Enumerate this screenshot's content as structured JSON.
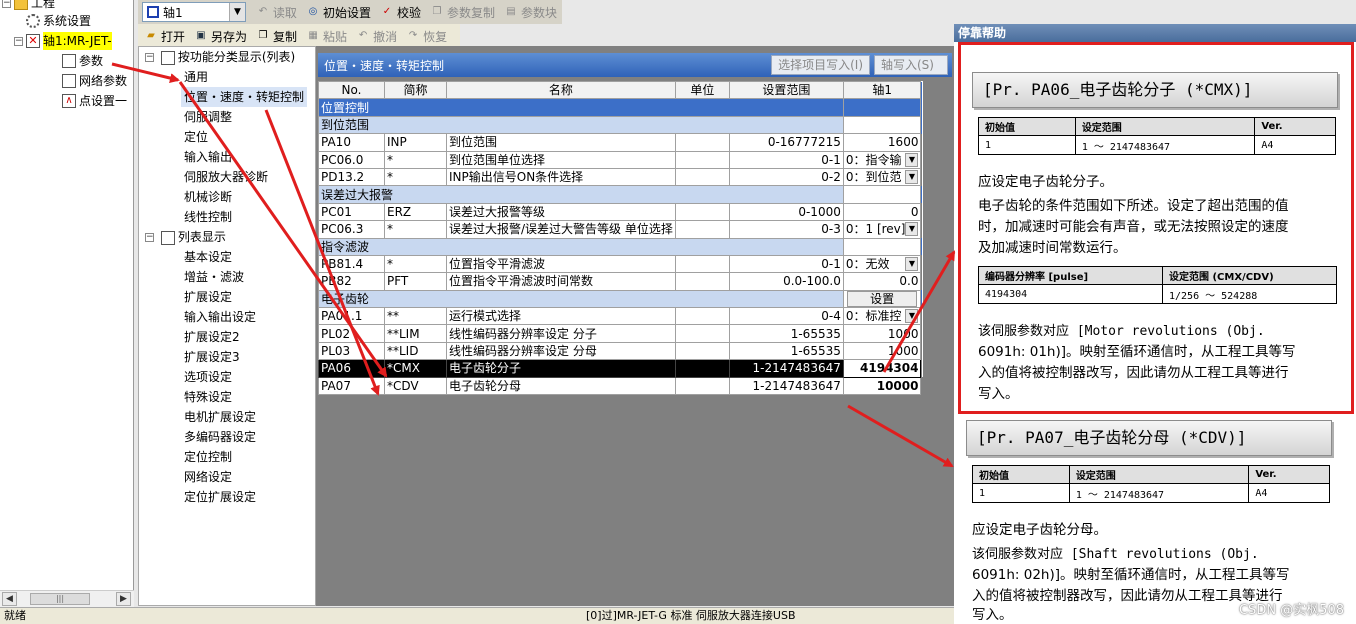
{
  "tree": {
    "project": "工程",
    "system_settings": "系统设置",
    "axis": "轴1:MR-JET-",
    "parameter": "参数",
    "network_parameter": "网络参数",
    "point_settings": "点设置一"
  },
  "toolbar": {
    "axis_select": "轴1",
    "read": "读取",
    "init_settings": "初始设置",
    "verify": "校验",
    "param_copy": "参数复制",
    "param_block": "参数块",
    "open": "打开",
    "save_as": "另存为",
    "copy": "复制",
    "paste": "粘贴",
    "undo": "撤消",
    "redo": "恢复"
  },
  "category": {
    "by_function": "按功能分类显示(列表)",
    "items_func": [
      "通用",
      "位置・速度・转矩控制",
      "伺服调整",
      "定位",
      "输入输出",
      "伺服放大器诊断",
      "机械诊断",
      "线性控制"
    ],
    "list_display": "列表显示",
    "items_list": [
      "基本设定",
      "增益・滤波",
      "扩展设定",
      "输入输出设定",
      "扩展设定2",
      "扩展设定3",
      "选项设定",
      "特殊设定",
      "电机扩展设定",
      "多编码器设定",
      "定位控制",
      "网络设定",
      "定位扩展设定"
    ]
  },
  "grid": {
    "title": "位置・速度・转矩控制",
    "btn_write_selected": "选择项目写入(I)",
    "btn_axis_write": "轴写入(S)",
    "columns": [
      "No.",
      "简称",
      "名称",
      "单位",
      "设置范围",
      "轴1"
    ],
    "section_position": "位置控制",
    "group_inpos": "到位范围",
    "group_error": "误差过大报警",
    "group_filter": "指令滤波",
    "group_gear": "电子齿轮",
    "gear_setting_btn": "设置",
    "rows_inpos": [
      {
        "no": "PA10",
        "abbr": "INP",
        "name": "到位范围",
        "unit": "",
        "range": "0-16777215",
        "value": "1600"
      },
      {
        "no": "PC06.0",
        "abbr": "*",
        "name": "到位范围单位选择",
        "unit": "",
        "range": "0-1",
        "value": "0：指令输"
      },
      {
        "no": "PD13.2",
        "abbr": "*",
        "name": "INP输出信号ON条件选择",
        "unit": "",
        "range": "0-2",
        "value": "0：到位范"
      }
    ],
    "rows_error": [
      {
        "no": "PC01",
        "abbr": "ERZ",
        "name": "误差过大报警等级",
        "unit": "",
        "range": "0-1000",
        "value": "0"
      },
      {
        "no": "PC06.3",
        "abbr": "*",
        "name": "误差过大报警/误差过大警告等级 单位选择",
        "unit": "",
        "range": "0-3",
        "value": "0：1 [rev]"
      }
    ],
    "rows_filter": [
      {
        "no": "PB81.4",
        "abbr": "*",
        "name": "位置指令平滑滤波",
        "unit": "",
        "range": "0-1",
        "value": "0：无效"
      },
      {
        "no": "PB82",
        "abbr": "PFT",
        "name": "位置指令平滑滤波时间常数",
        "unit": "",
        "range": "0.0-100.0",
        "value": "0.0"
      }
    ],
    "rows_gear": [
      {
        "no": "PA01.1",
        "abbr": "**",
        "name": "运行模式选择",
        "unit": "",
        "range": "0-4",
        "value": "0：标准控"
      },
      {
        "no": "PL02",
        "abbr": "**LIM",
        "name": "线性编码器分辨率设定 分子",
        "unit": "",
        "range": "1-65535",
        "value": "1000"
      },
      {
        "no": "PL03",
        "abbr": "**LID",
        "name": "线性编码器分辨率设定 分母",
        "unit": "",
        "range": "1-65535",
        "value": "1000"
      },
      {
        "no": "PA06",
        "abbr": "*CMX",
        "name": "电子齿轮分子",
        "unit": "",
        "range": "1-2147483647",
        "value": "4194304"
      },
      {
        "no": "PA07",
        "abbr": "*CDV",
        "name": "电子齿轮分母",
        "unit": "",
        "range": "1-2147483647",
        "value": "10000"
      }
    ]
  },
  "status": {
    "left": "就绪",
    "middle": "[0]过]MR-JET-G 标准 伺服放大器连接USB"
  },
  "help": {
    "title": "停靠帮助",
    "pa06": {
      "heading": "[Pr. PA06_电子齿轮分子 (*CMX)]",
      "headers": [
        "初始值",
        "设定范围",
        "Ver."
      ],
      "values": [
        "1",
        "1 ～ 2147483647",
        "A4"
      ],
      "line1": "应设定电子齿轮分子。",
      "para1": [
        "电子齿轮的条件范围如下所述。设定了超出范围的值",
        "时，加减速时可能会有声音，或无法按照设定的速度",
        "及加减速时间常数运行。"
      ],
      "enc_headers": [
        "编码器分辨率 [pulse]",
        "设定范围 (CMX/CDV)"
      ],
      "enc_values": [
        "4194304",
        "1/256 ～ 524288"
      ],
      "para2": [
        "该伺服参数对应 [Motor revolutions (Obj.",
        "6091h: 01h)]。映射至循环通信时，从工程工具等写",
        "入的值将被控制器改写，因此请勿从工程工具等进行",
        "写入。"
      ]
    },
    "pa07": {
      "heading": "[Pr. PA07_电子齿轮分母 (*CDV)]",
      "headers": [
        "初始值",
        "设定范围",
        "Ver."
      ],
      "values": [
        "1",
        "1 ～ 2147483647",
        "A4"
      ],
      "line1": "应设定电子齿轮分母。",
      "para2": [
        "该伺服参数对应 [Shaft revolutions (Obj.",
        "6091h: 02h)]。映射至循环通信时，从工程工具等写",
        "入的值将被控制器改写，因此请勿从工程工具等进行",
        "写入。"
      ]
    }
  },
  "watermark": "CSDN @实枫508",
  "colors": {
    "arrow": "#e01e1e",
    "selected_row": "#000000",
    "header_blue": "#3c6fc8"
  }
}
